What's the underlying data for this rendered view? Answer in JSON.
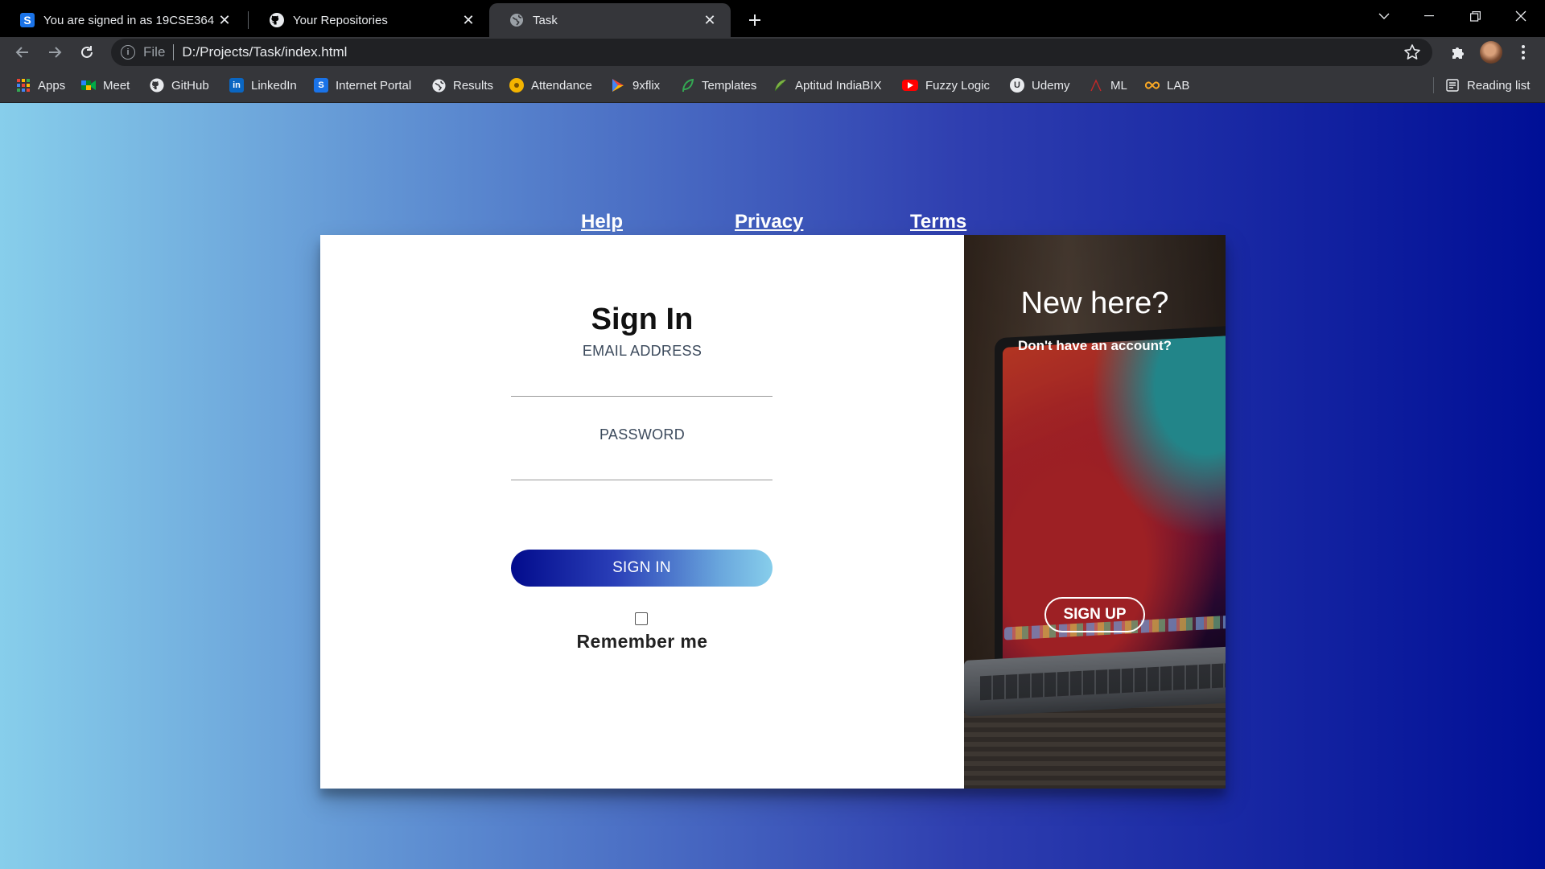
{
  "browser": {
    "tabs": [
      {
        "title": "You are signed in as 19CSE364",
        "icon": "s-brand-icon"
      },
      {
        "title": "Your Repositories",
        "icon": "github-icon"
      },
      {
        "title": "Task",
        "icon": "globe-icon"
      }
    ],
    "address": {
      "scheme": "File",
      "url": "D:/Projects/Task/index.html"
    },
    "bookmarks": [
      {
        "label": "Apps",
        "icon": "apps-grid-icon"
      },
      {
        "label": "Meet",
        "icon": "meet-icon"
      },
      {
        "label": "GitHub",
        "icon": "github-icon"
      },
      {
        "label": "LinkedIn",
        "icon": "linkedin-icon"
      },
      {
        "label": "Internet Portal",
        "icon": "s-brand-icon"
      },
      {
        "label": "Results",
        "icon": "globe-icon"
      },
      {
        "label": "Attendance",
        "icon": "attendance-icon"
      },
      {
        "label": "9xflix",
        "icon": "play-icon"
      },
      {
        "label": "Templates",
        "icon": "leaf-icon"
      },
      {
        "label": "Aptitud IndiaBIX",
        "icon": "feather-icon"
      },
      {
        "label": "Fuzzy Logic",
        "icon": "youtube-icon"
      },
      {
        "label": "Udemy",
        "icon": "udemy-icon"
      },
      {
        "label": "ML",
        "icon": "ml-icon"
      },
      {
        "label": "LAB",
        "icon": "infinity-icon"
      }
    ],
    "reading_list": "Reading list"
  },
  "page": {
    "links": {
      "help": "Help",
      "privacy": "Privacy",
      "terms": "Terms"
    },
    "signin": {
      "title": "Sign In",
      "email_label": "EMAIL ADDRESS",
      "password_label": "PASSWORD",
      "button": "SIGN IN",
      "remember": "Remember me"
    },
    "signup": {
      "title": "New here?",
      "subtitle": "Don't have an account?",
      "button": "SIGN UP"
    }
  },
  "colors": {
    "page_gradient_start": "#87ceeb",
    "page_gradient_end": "#000f96",
    "chrome_dark": "#35363a"
  }
}
